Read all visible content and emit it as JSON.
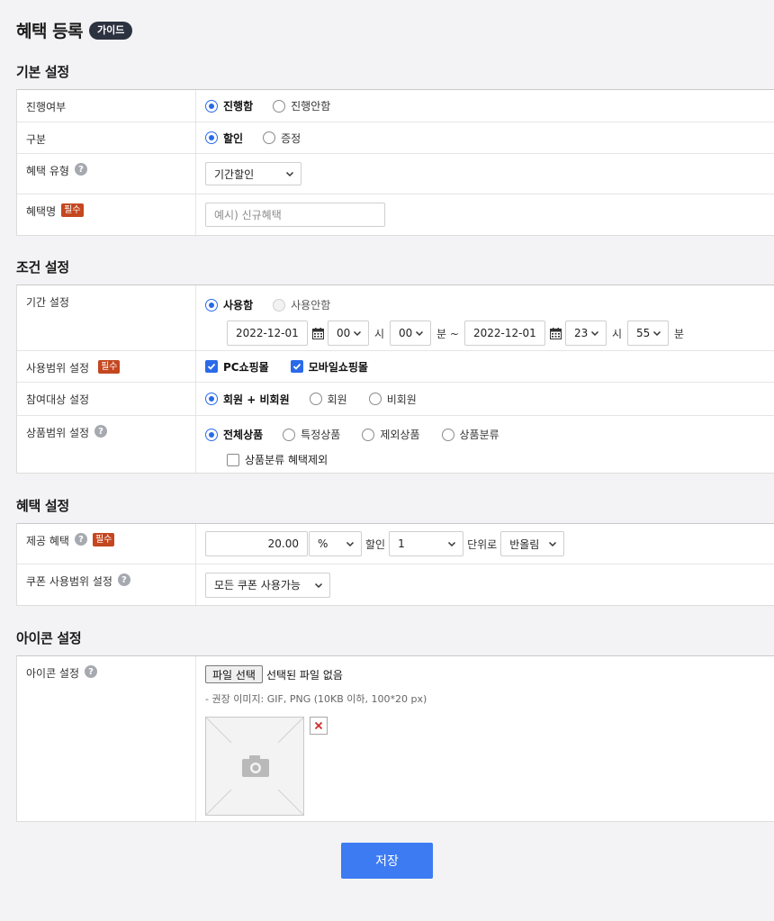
{
  "page": {
    "title": "혜택 등록",
    "guide_badge": "가이드",
    "save_label": "저장"
  },
  "colors": {
    "accent": "#3d7bf2",
    "check": "#2a6ae9",
    "required_badge": "#c4471f",
    "guide_badge": "#2d3240"
  },
  "basic": {
    "title": "기본 설정",
    "progress": {
      "label": "진행여부",
      "options": [
        "진행함",
        "진행안함"
      ],
      "selected": "진행함"
    },
    "category": {
      "label": "구분",
      "options": [
        "할인",
        "증정"
      ],
      "selected": "할인"
    },
    "benefit_type": {
      "label": "혜택 유형",
      "value": "기간할인"
    },
    "benefit_name": {
      "label": "혜택명",
      "required": "필수",
      "placeholder": "예시) 신규혜택"
    }
  },
  "condition": {
    "title": "조건 설정",
    "period": {
      "label": "기간 설정",
      "options": [
        "사용함",
        "사용안함"
      ],
      "selected": "사용함",
      "start_date": "2022-12-01",
      "start_hour": "00",
      "start_min": "00",
      "end_date": "2022-12-01",
      "end_hour": "23",
      "end_min": "55",
      "hour_unit": "시",
      "min_unit": "분",
      "range_sep": "분 ~"
    },
    "scope": {
      "label": "사용범위 설정",
      "required": "필수",
      "options": [
        "PC쇼핑몰",
        "모바일쇼핑몰"
      ]
    },
    "target": {
      "label": "참여대상 설정",
      "options": [
        "회원 + 비회원",
        "회원",
        "비회원"
      ],
      "selected": "회원 + 비회원"
    },
    "product_scope": {
      "label": "상품범위 설정",
      "options": [
        "전체상품",
        "특정상품",
        "제외상품",
        "상품분류"
      ],
      "selected": "전체상품",
      "exclude_label": "상품분류 혜택제외"
    }
  },
  "benefit": {
    "title": "혜택 설정",
    "provide": {
      "label": "제공 혜택",
      "required": "필수",
      "amount": "20.00",
      "unit": "%",
      "discount_text": "할인",
      "round_unit": "1",
      "round_text": "단위로",
      "round_mode": "반올림"
    },
    "coupon": {
      "label": "쿠폰 사용범위 설정",
      "value": "모든 쿠폰 사용가능"
    }
  },
  "icon": {
    "title": "아이콘 설정",
    "row": {
      "label": "아이콘 설정",
      "file_button": "파일 선택",
      "file_status": "선택된 파일 없음",
      "hint": "- 권장 이미지: GIF, PNG (10KB 이하, 100*20 px)"
    }
  }
}
